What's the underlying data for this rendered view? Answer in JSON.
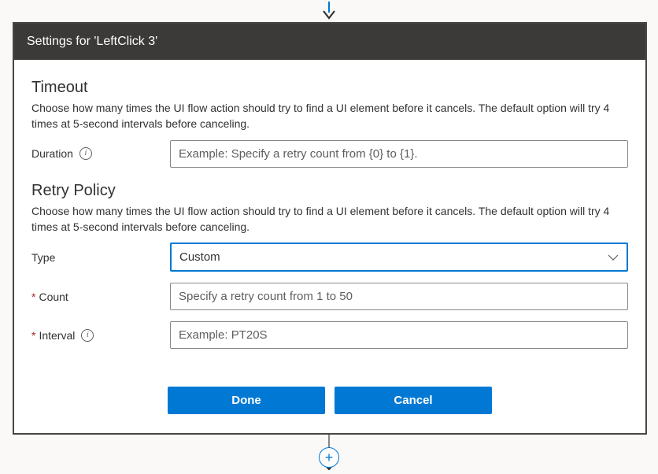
{
  "header": {
    "title": "Settings for 'LeftClick 3'"
  },
  "timeout": {
    "section_title": "Timeout",
    "description": "Choose how many times the UI flow action should try to find a UI element before it cancels. The default option will try 4 times at 5-second intervals before canceling.",
    "duration_label": "Duration",
    "duration_placeholder": "Example: Specify a retry count from {0} to {1}."
  },
  "retry": {
    "section_title": "Retry Policy",
    "description": "Choose how many times the UI flow action should try to find a UI element before it cancels. The default option will try 4 times at 5-second intervals before canceling.",
    "type_label": "Type",
    "type_value": "Custom",
    "count_label": "Count",
    "count_placeholder": "Specify a retry count from 1 to 50",
    "interval_label": "Interval",
    "interval_placeholder": "Example: PT20S"
  },
  "buttons": {
    "done": "Done",
    "cancel": "Cancel"
  },
  "icons": {
    "plus": "+"
  }
}
